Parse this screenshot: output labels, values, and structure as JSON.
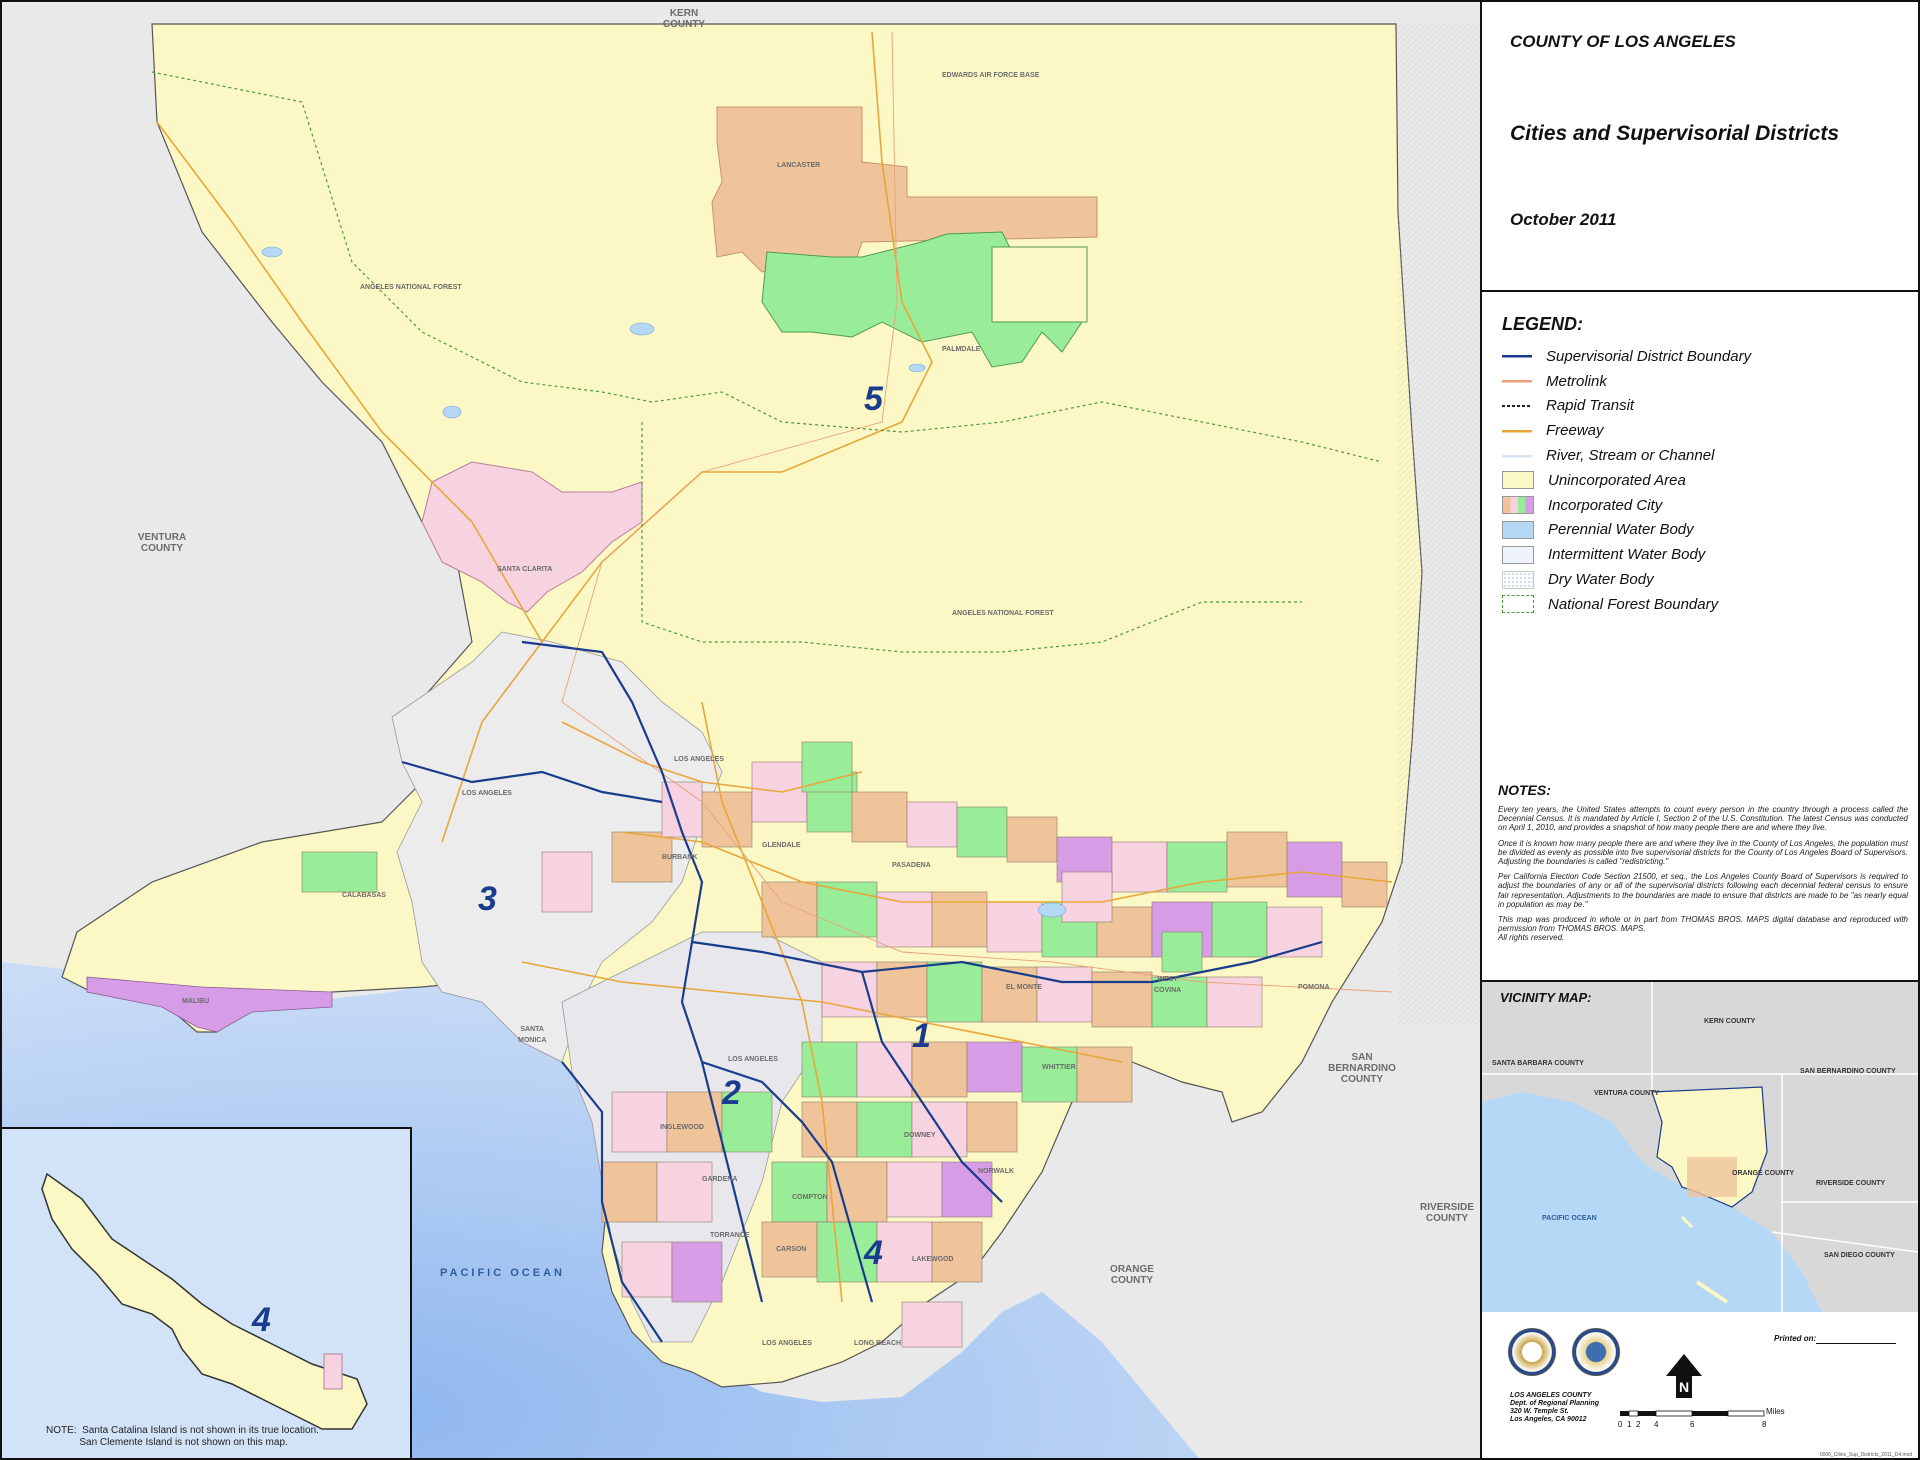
{
  "map": {
    "adjacent": {
      "kern_county": "KERN\nCOUNTY",
      "ventura_county": "VENTURA\nCOUNTY",
      "san_bernardino_county": "SAN\nBERNARDINO\nCOUNTY",
      "riverside_county": "RIVERSIDE\nCOUNTY",
      "orange_county": "ORANGE\nCOUNTY",
      "pacific_ocean": "PACIFIC OCEAN"
    },
    "districts": [
      "1",
      "2",
      "3",
      "4",
      "5"
    ],
    "inset_district": "4",
    "place_labels": {
      "edwards": "EDWARDS AIR FORCE BASE",
      "lancaster": "LANCASTER",
      "palmdale": "PALMDALE",
      "angeles_nf_1": "ANGELES NATIONAL FOREST",
      "angeles_nf_2": "ANGELES NATIONAL FOREST",
      "santa_clarita": "SANTA CLARITA",
      "los_angeles_1": "LOS ANGELES",
      "los_angeles_2": "LOS ANGELES",
      "los_angeles_3": "LOS ANGELES",
      "los_angeles_4": "LOS ANGELES",
      "burbank": "BURBANK",
      "glendale": "GLENDALE",
      "pasadena": "PASADENA",
      "calabasas": "CALABASAS",
      "malibu": "MALIBU",
      "santa_monica": "SANTA\nMONICA",
      "inglewood": "INGLEWOOD",
      "compton": "COMPTON",
      "torrance": "TORRANCE",
      "carson": "CARSON",
      "long_beach": "LONG BEACH",
      "downey": "DOWNEY",
      "pomona": "POMONA",
      "west_covina": "WEST\nCOVINA",
      "el_monte": "EL MONTE",
      "whittier": "WHITTIER",
      "gardena": "GARDENA",
      "lakewood": "LAKEWOOD",
      "norwalk": "NORWALK"
    },
    "inset_note": "NOTE:  Santa Catalina Island is not shown in its true location.\n            San Clemente Island is not shown on this map."
  },
  "title": {
    "county": "COUNTY OF LOS ANGELES",
    "map_title": "Cities and Supervisorial Districts",
    "date": "October 2011"
  },
  "legend": {
    "title": "LEGEND:",
    "items": [
      {
        "label": "Supervisorial District Boundary",
        "kind": "line",
        "color": "#1a3c8c"
      },
      {
        "label": "Metrolink",
        "kind": "line",
        "color": "#e9a27a"
      },
      {
        "label": "Rapid Transit",
        "kind": "dashed",
        "color": "#222222"
      },
      {
        "label": "Freeway",
        "kind": "line",
        "color": "#e8a63a"
      },
      {
        "label": "River, Stream or Channel",
        "kind": "line",
        "color": "#d9e4f2"
      },
      {
        "label": "Unincorporated Area",
        "kind": "fill",
        "color": "#fbf8c6"
      },
      {
        "label": "Incorporated City",
        "kind": "multi",
        "color": "#f0c49a"
      },
      {
        "label": "Perennial Water Body",
        "kind": "fill",
        "color": "#b6d8f7"
      },
      {
        "label": "Intermittent Water Body",
        "kind": "fill",
        "color": "#eef3fb"
      },
      {
        "label": "Dry Water Body",
        "kind": "dots",
        "color": "#c8dbf2"
      },
      {
        "label": "National Forest Boundary",
        "kind": "forest",
        "color": "#4d9a3a"
      }
    ]
  },
  "notes": {
    "title": "NOTES:",
    "paragraphs": [
      "Every ten years, the United States attempts to count every person in the country through a process called the Decennial Census.  It is mandated by Article I, Section 2 of the U.S. Constitution.  The latest Census was conducted on April 1, 2010, and provides a snapshot of how many people there are and where they live.",
      "Once it is known how many people there are and where they live in the County of Los Angeles, the population must be divided as evenly as possible into five supervisorial districts for the County of Los Angeles Board of Supervisors.  Adjusting the boundaries is called \"redistricting.\"",
      "Per California Election Code Section 21500, et seq., the Los Angeles County Board of Supervisors is required to adjust the boundaries of any or all of the supervisorial districts following each decennial federal census to ensure fair representation.  Adjustments to the boundaries are made to ensure that districts are made to be \"as nearly equal in population as may be.\"",
      "This map was produced in whole or in part from THOMAS BROS. MAPS digital database and reproduced with permission from THOMAS BROS. MAPS.\nAll rights reserved."
    ]
  },
  "vicinity": {
    "title": "VICINITY MAP:",
    "labels": {
      "kern": "KERN COUNTY",
      "santa_barbara": "SANTA BARBARA COUNTY",
      "san_bernardino": "SAN BERNARDINO COUNTY",
      "ventura": "VENTURA COUNTY",
      "orange": "ORANGE COUNTY",
      "riverside": "RIVERSIDE COUNTY",
      "pacific": "PACIFIC OCEAN",
      "san_diego": "SAN DIEGO COUNTY"
    }
  },
  "footer": {
    "printed_on": "Printed on:",
    "dept_lines": "LOS ANGELES COUNTY\nDept. of Regional Planning\n320 W. Temple St.\nLos Angeles, CA 90012",
    "scale_unit": "Miles",
    "scale_ticks": [
      "0",
      "1",
      "2",
      "4",
      "6",
      "8"
    ],
    "north": "N",
    "file_id": "0006_Cities_Sup_Districts_2011_D4.mxd"
  }
}
